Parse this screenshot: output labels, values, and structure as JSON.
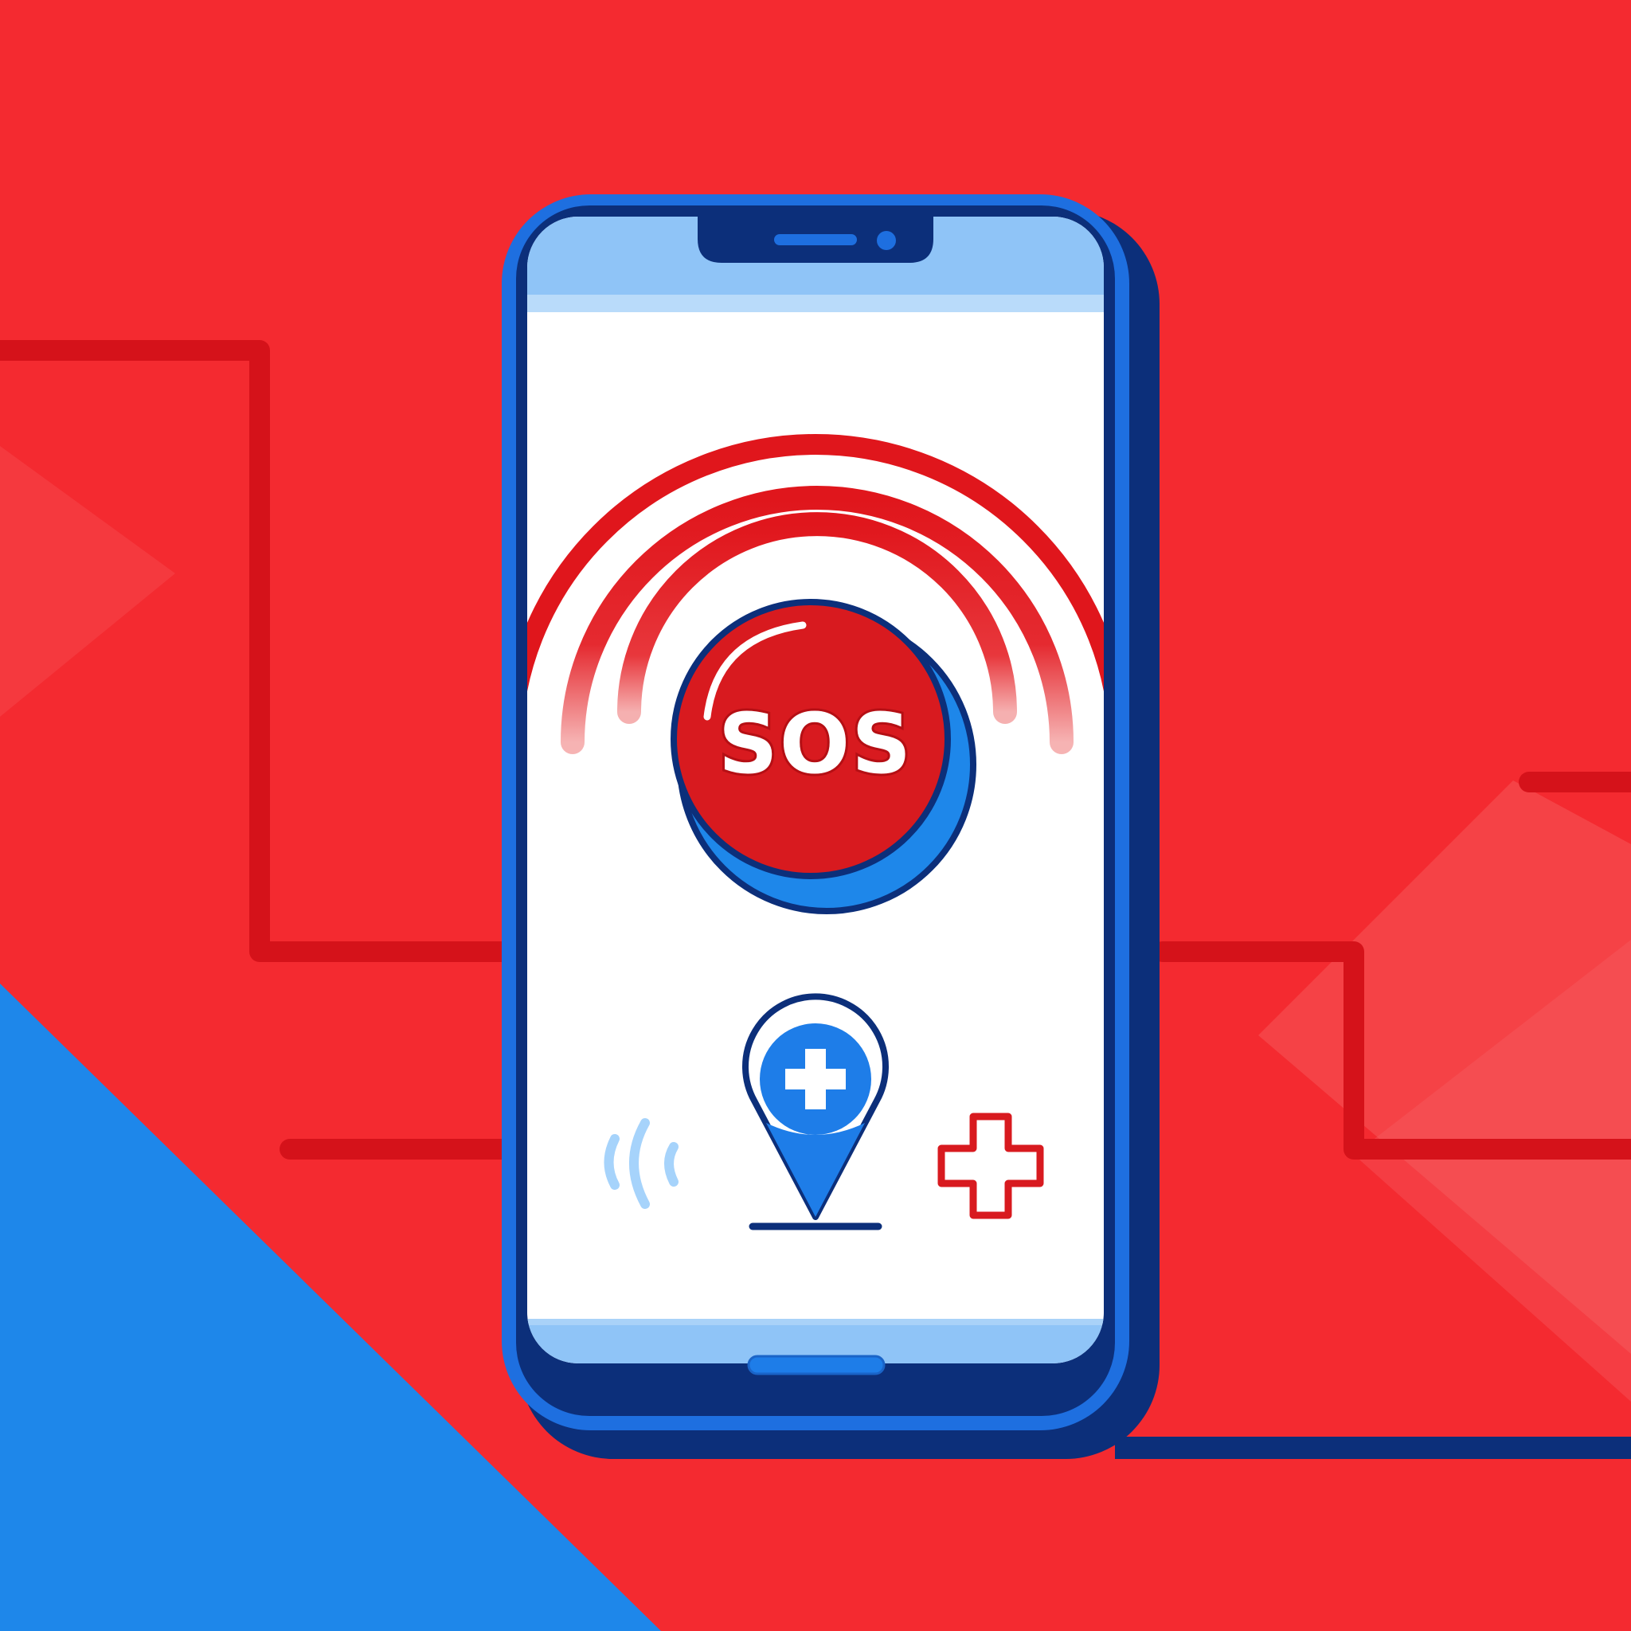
{
  "sos_button": {
    "label": "SOS"
  },
  "colors": {
    "background_red": "#f42a30",
    "background_blue": "#1e87ea",
    "circuit_line": "#d5121a",
    "phone_frame": "#1e6fe0",
    "phone_outline": "#0c2f7a",
    "screen_bar": "#8fc4f7",
    "sos_red": "#d81a1f",
    "wave_red": "#e0161c",
    "location_pin": "#1e7de8",
    "medical_cross": "#d81a1f",
    "signal_waves": "#a6d3fb"
  },
  "icons": [
    "signal-waves-icon",
    "location-pin-icon",
    "medical-cross-icon"
  ]
}
